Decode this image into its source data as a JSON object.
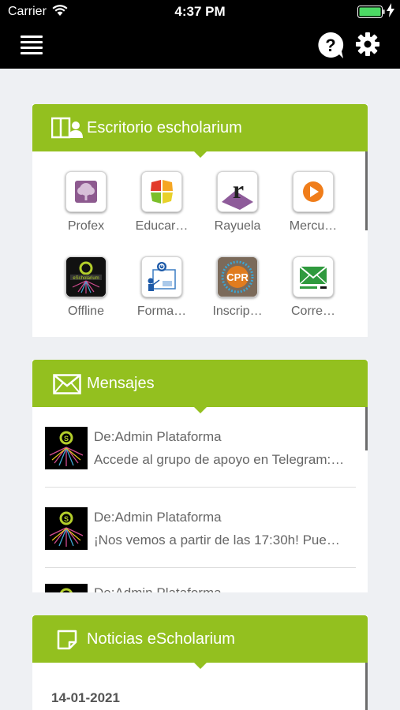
{
  "status_bar": {
    "carrier": "Carrier",
    "time": "4:37 PM"
  },
  "nav": {
    "menu_icon": "hamburger-menu-icon",
    "help_icon": "help-bubble-icon",
    "settings_icon": "gear-icon"
  },
  "colors": {
    "accent": "#93c01f",
    "nav_background": "#000000",
    "page_background": "#eef0f3"
  },
  "escritorio": {
    "title": "Escritorio escholarium",
    "icon": "user-desk-icon",
    "apps": [
      {
        "label": "Profex",
        "icon": "profex-tree-icon"
      },
      {
        "label": "Educar…",
        "icon": "educarex-tiles-icon"
      },
      {
        "label": "Rayuela",
        "icon": "rayuela-r-icon"
      },
      {
        "label": "Mercu…",
        "icon": "mercurio-play-icon"
      },
      {
        "label": "Offline",
        "icon": "escholarium-offline-icon"
      },
      {
        "label": "Forma…",
        "icon": "formacion-presentation-icon"
      },
      {
        "label": "Inscrip…",
        "icon": "cpr-inscripcion-icon",
        "badge": "CPR"
      },
      {
        "label": "Corre…",
        "icon": "correo-envelope-icon"
      }
    ]
  },
  "mensajes": {
    "title": "Mensajes",
    "icon": "envelope-icon",
    "items": [
      {
        "from": "De:Admin Plataforma",
        "text": "Accede al grupo de apoyo en Telegram:…"
      },
      {
        "from": "De:Admin Plataforma",
        "text": "¡Nos vemos a partir de las 17:30h! Pue…"
      },
      {
        "from": "De:Admin Plataforma",
        "text": ""
      }
    ]
  },
  "noticias": {
    "title": "Noticias eScholarium",
    "icon": "note-icon",
    "date": "14-01-2021"
  }
}
